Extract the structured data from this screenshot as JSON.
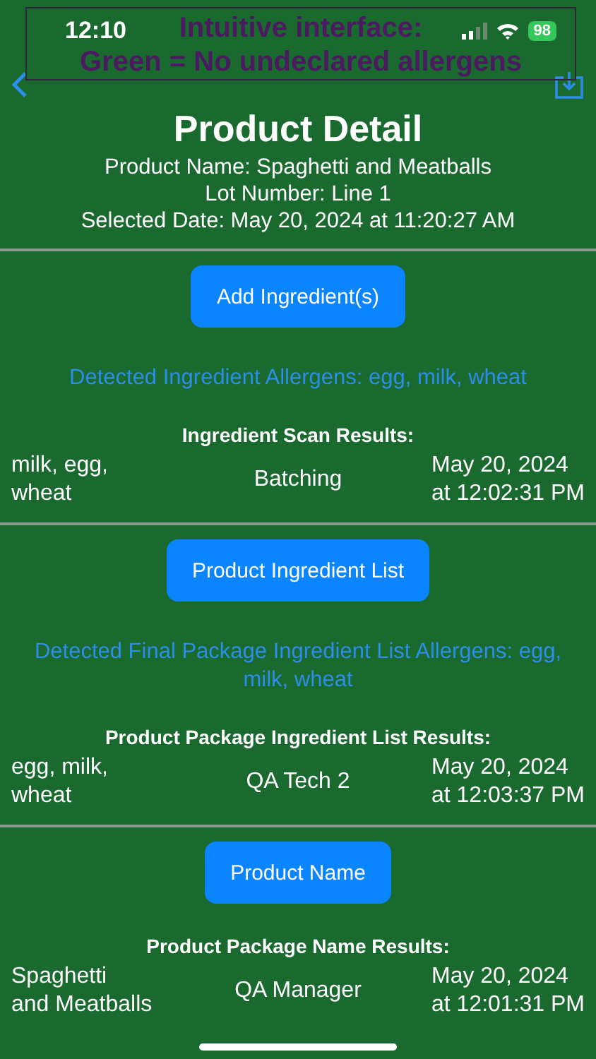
{
  "status_bar": {
    "time": "12:10",
    "battery": "98"
  },
  "caption": {
    "lines": [
      "Intuitive interface:",
      "Green = No undeclared allergens"
    ]
  },
  "header": {
    "title": "Product Detail",
    "lines": [
      "Product Name: Spaghetti and Meatballs",
      "Lot Number: Line 1",
      "Selected Date: May 20, 2024 at 11:20:27 AM"
    ]
  },
  "sections": [
    {
      "button": "Add Ingredient(s)",
      "allergens": "Detected Ingredient Allergens: egg, milk, wheat",
      "results_title": "Ingredient Scan Results:",
      "result": {
        "item": [
          "milk, egg,",
          "wheat"
        ],
        "user": "Batching",
        "date": [
          "May 20, 2024",
          "at 12:02:31 PM"
        ]
      }
    },
    {
      "button": "Product Ingredient List",
      "allergens": "Detected Final Package Ingredient List Allergens: egg, milk, wheat",
      "results_title": "Product Package Ingredient List Results:",
      "result": {
        "item": [
          "egg, milk,",
          "wheat"
        ],
        "user": "QA Tech 2",
        "date": [
          "May 20, 2024",
          "at 12:03:37 PM"
        ]
      }
    },
    {
      "button": "Product Name",
      "results_title": "Product Package Name Results:",
      "result": {
        "item": [
          "Spaghetti",
          "and Meatballs"
        ],
        "user": "QA Manager",
        "date": [
          "May 20, 2024",
          "at 12:01:31 PM"
        ]
      }
    }
  ]
}
